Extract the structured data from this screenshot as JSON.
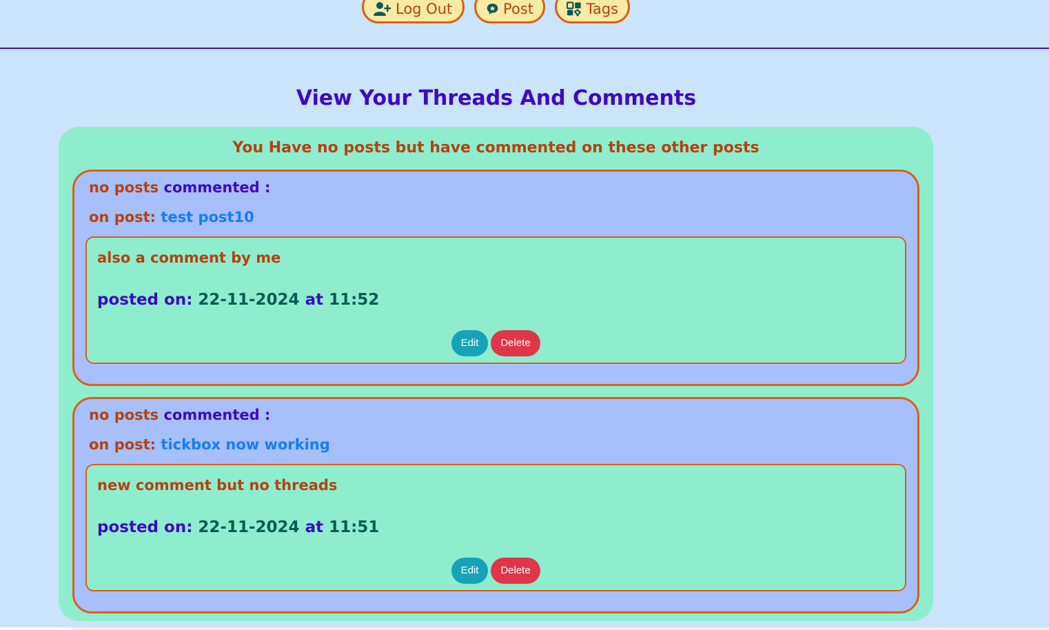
{
  "nav": {
    "items": [
      {
        "label": "Log Out",
        "icon": "user-plus-icon"
      },
      {
        "label": "Post",
        "icon": "comment-star-icon"
      },
      {
        "label": "Tags",
        "icon": "tags-icon"
      }
    ]
  },
  "page": {
    "title": "View Your Threads And Comments",
    "subtitle": "You Have no posts but have commented on these other posts"
  },
  "threads": [
    {
      "no_posts_label": "no posts",
      "commented_label": "commented :",
      "on_post_label": "on post:",
      "post_title": "test post10",
      "comment": {
        "text": "also a comment by me",
        "posted_on_label": "posted on:",
        "date": "22-11-2024",
        "at_label": "at",
        "time": "11:52",
        "edit_label": "Edit",
        "delete_label": "Delete"
      }
    },
    {
      "no_posts_label": "no posts",
      "commented_label": "commented :",
      "on_post_label": "on post:",
      "post_title": "tickbox now working",
      "comment": {
        "text": "new comment but no threads",
        "posted_on_label": "posted on:",
        "date": "22-11-2024",
        "at_label": "at",
        "time": "11:51",
        "edit_label": "Edit",
        "delete_label": "Delete"
      }
    }
  ],
  "colors": {
    "page_bg": "#c9e4fb",
    "nav_button_bg": "#f9eaa4",
    "accent_orange": "#d9601a",
    "heading_purple": "#3d0ac2",
    "panel_green": "#8eedcd",
    "card_blue": "#a7bffb",
    "link_blue": "#147ef5",
    "edit_teal": "#17a2b8",
    "delete_red": "#e0364a"
  }
}
